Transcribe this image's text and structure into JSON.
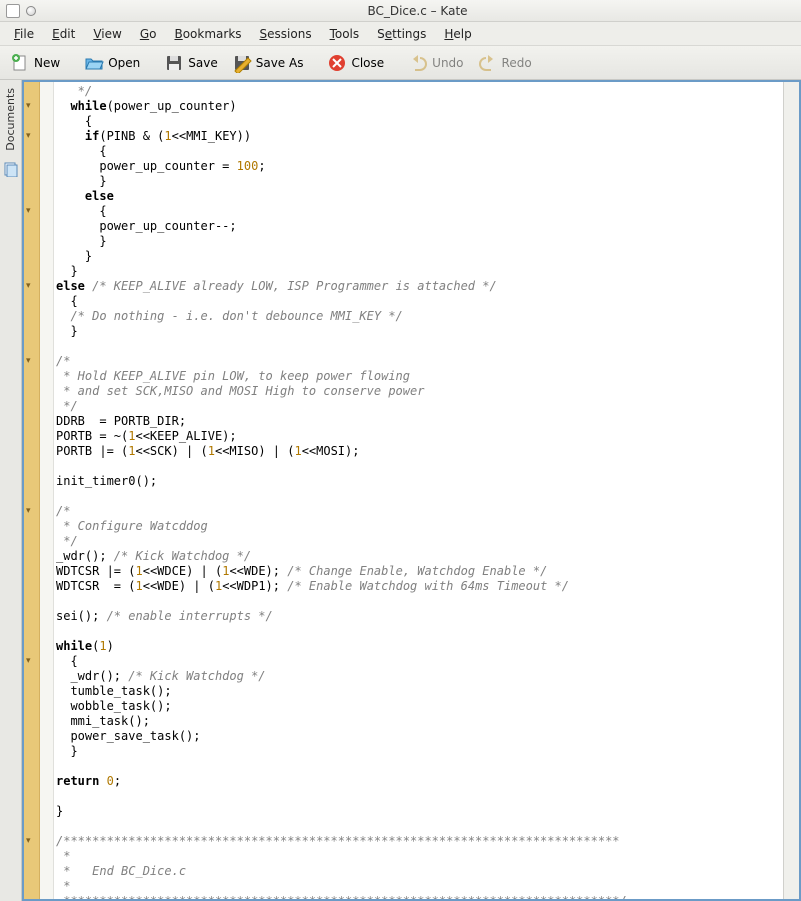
{
  "window": {
    "title": "BC_Dice.c – Kate"
  },
  "menu": {
    "file": "File",
    "edit": "Edit",
    "view": "View",
    "go": "Go",
    "bookmarks": "Bookmarks",
    "sessions": "Sessions",
    "tools": "Tools",
    "settings": "Settings",
    "help": "Help"
  },
  "toolbar": {
    "new": "New",
    "open": "Open",
    "save": "Save",
    "save_as": "Save As",
    "close": "Close",
    "undo": "Undo",
    "redo": "Redo"
  },
  "sidebar": {
    "documents": "Documents"
  },
  "code": {
    "l1": "   */",
    "l2a": "  while",
    "l2b": "(power_up_counter)",
    "l3": "    {",
    "l4a": "    if",
    "l4b": "(PINB & (",
    "l4c": "1",
    "l4d": "<<MMI_KEY))",
    "l5": "      {",
    "l6a": "      power_up_counter = ",
    "l6b": "100",
    "l6c": ";",
    "l7": "      }",
    "l8": "    else",
    "l9": "      {",
    "l10": "      power_up_counter--;",
    "l11": "      }",
    "l12": "    }",
    "l13": "  }",
    "l14a": "else",
    "l14b": " /* KEEP_ALIVE already LOW, ISP Programmer is attached */",
    "l15": "  {",
    "l16": "  /* Do nothing - i.e. don't debounce MMI_KEY */",
    "l17": "  }",
    "l18": "",
    "l19": "/*",
    "l20": " * Hold KEEP_ALIVE pin LOW, to keep power flowing",
    "l21": " * and set SCK,MISO and MOSI High to conserve power",
    "l22": " */",
    "l23": "DDRB  = PORTB_DIR;",
    "l24a": "PORTB = ~(",
    "l24b": "1",
    "l24c": "<<KEEP_ALIVE);",
    "l25a": "PORTB |= (",
    "l25b": "1",
    "l25c": "<<SCK) | (",
    "l25d": "1",
    "l25e": "<<MISO) | (",
    "l25f": "1",
    "l25g": "<<MOSI);",
    "l26": "",
    "l27": "init_timer0();",
    "l28": "",
    "l29": "/*",
    "l30": " * Configure Watcddog",
    "l31": " */",
    "l32a": "_wdr(); ",
    "l32b": "/* Kick Watchdog */",
    "l33a": "WDTCSR |= (",
    "l33b": "1",
    "l33c": "<<WDCE) | (",
    "l33d": "1",
    "l33e": "<<WDE); ",
    "l33f": "/* Change Enable, Watchdog Enable */",
    "l34a": "WDTCSR  = (",
    "l34b": "1",
    "l34c": "<<WDE) | (",
    "l34d": "1",
    "l34e": "<<WDP1); ",
    "l34f": "/* Enable Watchdog with 64ms Timeout */",
    "l35": "",
    "l36a": "sei(); ",
    "l36b": "/* enable interrupts */",
    "l37": "",
    "l38a": "while",
    "l38b": "(",
    "l38c": "1",
    "l38d": ")",
    "l39": "  {",
    "l40a": "  _wdr(); ",
    "l40b": "/* Kick Watchdog */",
    "l41": "  tumble_task();",
    "l42": "  wobble_task();",
    "l43": "  mmi_task();",
    "l44": "  power_save_task();",
    "l45": "  }",
    "l46": "",
    "l47a": "return",
    "l47b": " ",
    "l47c": "0",
    "l47d": ";",
    "l48": "",
    "l49": "}",
    "l50": "",
    "l51": "/*****************************************************************************",
    "l52": " *",
    "l53": " *   End BC_Dice.c",
    "l54": " *",
    "l55": " *****************************************************************************/"
  }
}
